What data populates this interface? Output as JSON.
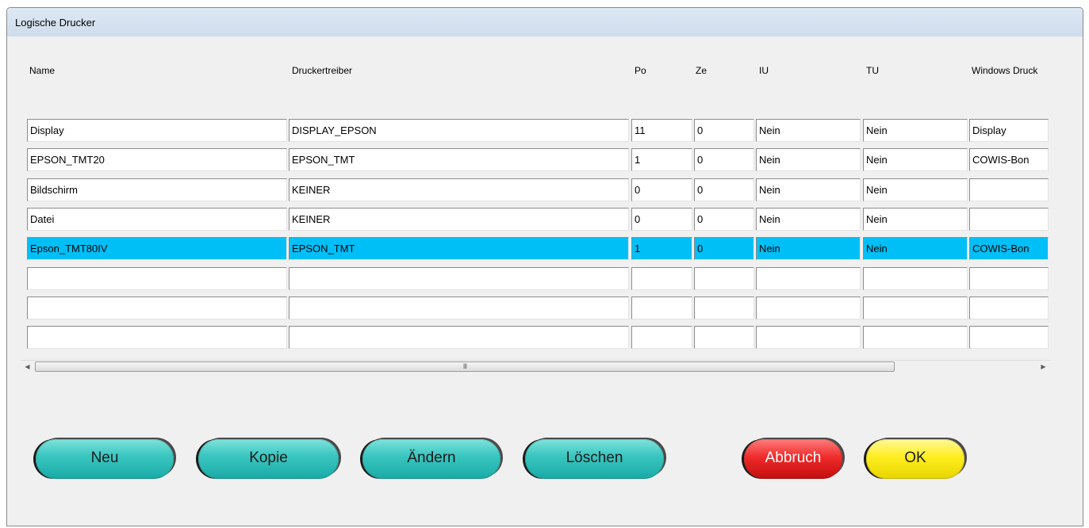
{
  "window": {
    "title": "Logische Drucker"
  },
  "table": {
    "headers": [
      "Name",
      "Druckertreiber",
      "Po",
      "Ze",
      "IU",
      "TU",
      "Windows Druck"
    ],
    "rows": [
      [
        "Display",
        "DISPLAY_EPSON",
        "11",
        "0",
        "Nein",
        "Nein",
        "Display"
      ],
      [
        "EPSON_TMT20",
        "EPSON_TMT",
        "1",
        "0",
        "Nein",
        "Nein",
        "COWIS-Bon"
      ],
      [
        "Bildschirm",
        "KEINER",
        "0",
        "0",
        "Nein",
        "Nein",
        ""
      ],
      [
        "Datei",
        "KEINER",
        "0",
        "0",
        "Nein",
        "Nein",
        ""
      ],
      [
        "Epson_TMT80IV",
        "EPSON_TMT",
        "1",
        "0",
        "Nein",
        "Nein",
        "COWIS-Bon"
      ],
      [
        "",
        "",
        "",
        "",
        "",
        "",
        ""
      ],
      [
        "",
        "",
        "",
        "",
        "",
        "",
        ""
      ],
      [
        "",
        "",
        "",
        "",
        "",
        "",
        ""
      ]
    ],
    "selected_row": 4,
    "selection_color": "#00bff7"
  },
  "scrollbar": {
    "left_arrow": "◀",
    "right_arrow": "▶",
    "grip": "III"
  },
  "buttons": {
    "neu": "Neu",
    "kopie": "Kopie",
    "aendern": "Ändern",
    "loeschen": "Löschen",
    "abbruch": "Abbruch",
    "ok": "OK"
  },
  "colors": {
    "teal_button": "#3cc7c1",
    "red_button": "#ef2b2b",
    "yellow_button": "#ffee1f"
  }
}
